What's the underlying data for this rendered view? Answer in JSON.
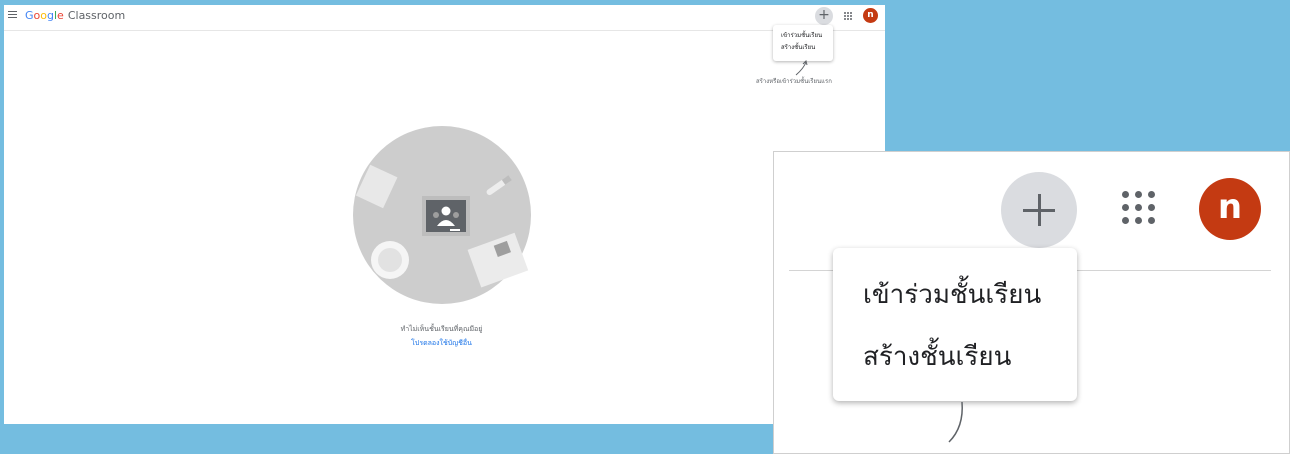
{
  "app": {
    "logo_google": [
      "G",
      "o",
      "o",
      "g",
      "l",
      "e"
    ],
    "product_name": "Classroom"
  },
  "header": {
    "add_button_symbol": "+",
    "avatar_letter": "n"
  },
  "add_menu": {
    "items": [
      {
        "label": "เข้าร่วมชั้นเรียน"
      },
      {
        "label": "สร้างชั้นเรียน"
      }
    ]
  },
  "hint_text": "สร้างหรือเข้าร่วมชั้นเรียนแรก",
  "empty_state": {
    "title": "ทำไม่เห็นชั้นเรียนที่คุณมีอยู่",
    "link": "โปรดลองใช้บัญชีอื่น"
  },
  "zoom_inset": {
    "avatar_letter": "n",
    "menu_items": [
      {
        "label": "เข้าร่วมชั้นเรียน"
      },
      {
        "label": "สร้างชั้นเรียน"
      }
    ]
  },
  "colors": {
    "background": "#74bde0",
    "avatar": "#c43a12",
    "plus_button": "#dadce0",
    "link": "#1a73e8"
  },
  "icons": [
    "menu-icon",
    "plus-icon",
    "apps-grid-icon",
    "avatar",
    "classroom-board-icon"
  ]
}
